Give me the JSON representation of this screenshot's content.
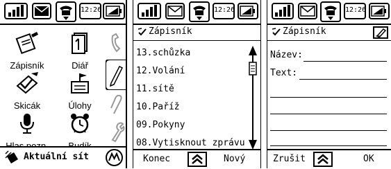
{
  "status_bar": {
    "time": "12:26"
  },
  "launcher": {
    "apps": [
      {
        "label": "Zápisník",
        "icon": "notepad-icon"
      },
      {
        "label": "Diář",
        "icon": "diary-icon"
      },
      {
        "label": "Skicák",
        "icon": "sketchpad-icon"
      },
      {
        "label": "Úlohy",
        "icon": "tasks-icon"
      },
      {
        "label": "Hlas.pozn.",
        "icon": "microphone-icon"
      },
      {
        "label": "Budík",
        "icon": "alarm-clock-icon"
      }
    ],
    "side_tabs": [
      "phone-icon",
      "pencil-icon",
      "paperclip-icon",
      "wrench-icon"
    ],
    "bottom_text": "Aktuální sít"
  },
  "notes_list": {
    "title": "Zápisník",
    "items": [
      "13.schůzka",
      "12.Volání",
      "11.sítě",
      "10.Paříž",
      "09.Pokyny",
      "08.Vytisknout zprávu"
    ],
    "footer_left": "Konec",
    "footer_right": "Nový"
  },
  "note_edit": {
    "title": "Zápisník",
    "name_label": "Název:",
    "text_label": "Text:",
    "footer_left": "Zrušit",
    "footer_right": "OK"
  }
}
